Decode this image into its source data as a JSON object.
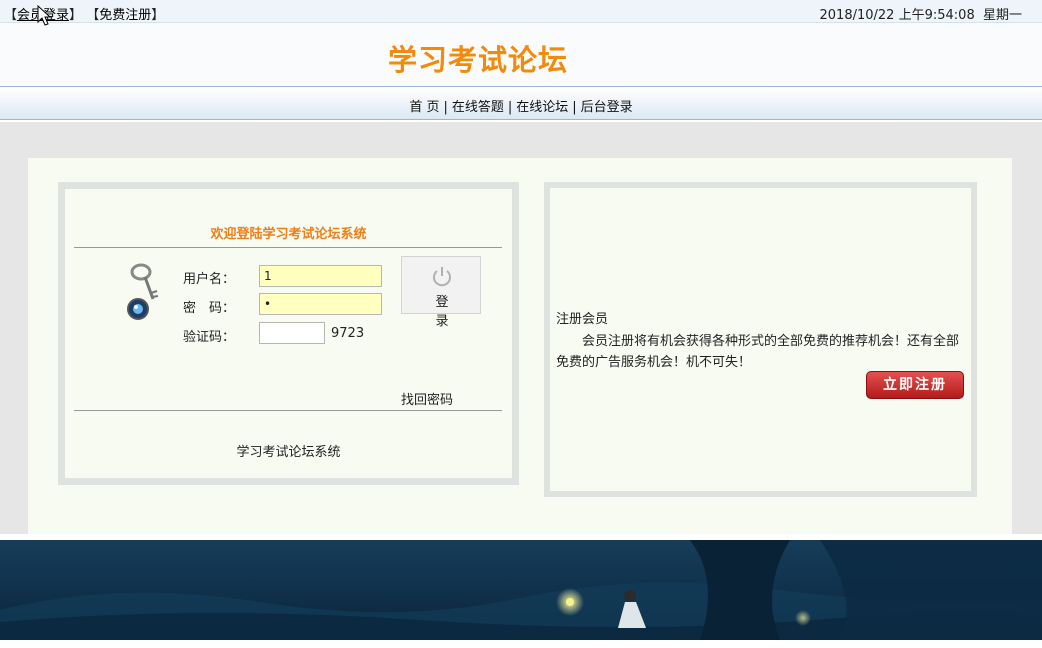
{
  "topbar": {
    "login_link": "会员登录",
    "register_link": "免费注册",
    "date": "2018/10/22",
    "time": "上午9:54:08",
    "weekday": "星期一"
  },
  "header": {
    "title": "学习考试论坛"
  },
  "nav": {
    "items": [
      "首 页",
      "在线答题",
      "在线论坛",
      "后台登录"
    ]
  },
  "login": {
    "title": "欢迎登陆学习考试论坛系统",
    "username_label": "用户名：",
    "username_value": "1",
    "password_label": "密　码：",
    "password_value": "•",
    "captcha_label": "验证码：",
    "captcha_value": "",
    "captcha_code": "9723",
    "login_button": "登录",
    "forgot_link": "找回密码",
    "footer": "学习考试论坛系统"
  },
  "register": {
    "heading": "注册会员",
    "description": "会员注册将有机会获得各种形式的全部免费的推荐机会！还有全部免费的广告服务机会！机不可失！",
    "button": "立即注册"
  },
  "colors": {
    "title_orange": "#f28a0b",
    "register_red": "#c42424",
    "input_yellow": "#ffffc0"
  },
  "icons": [
    "key-icon",
    "power-icon",
    "cursor-icon"
  ]
}
